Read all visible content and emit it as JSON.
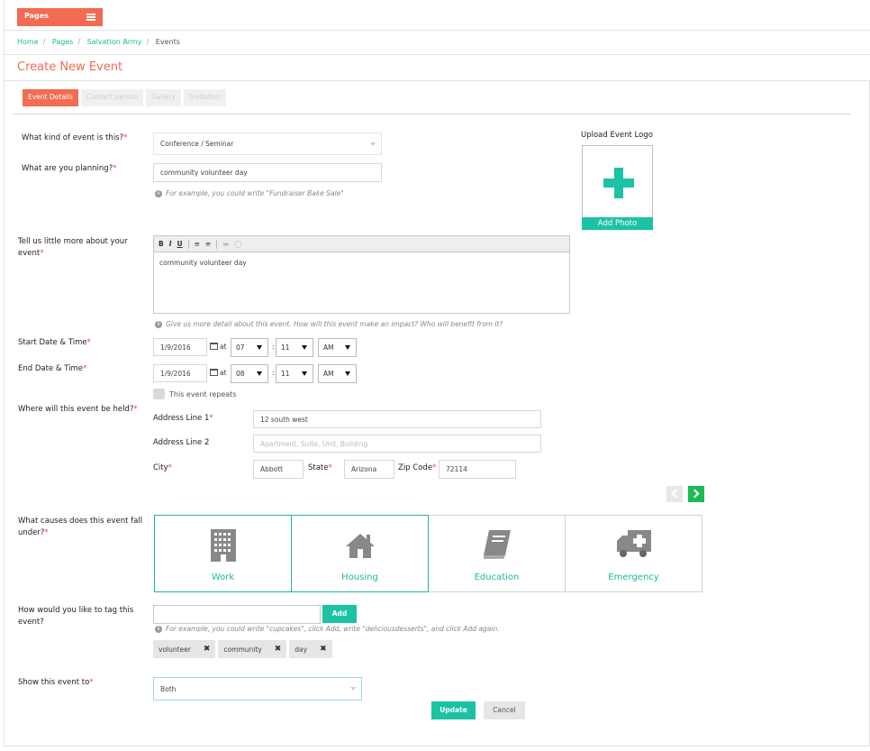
{
  "header": {
    "pages_label": "Pages"
  },
  "breadcrumb": [
    "Home",
    "Pages",
    "Salvation Army",
    "Events"
  ],
  "page_title": "Create New Event",
  "tabs": [
    "Event Details",
    "Contact person",
    "Gallery",
    "Invitation"
  ],
  "form": {
    "event_kind": {
      "label": "What kind of event is this?",
      "value": "Conference / Seminar"
    },
    "planning": {
      "label": "What are you planning?",
      "value": "community volunteer day",
      "hint": "For example, you could write \"Fundraiser Bake Sale\""
    },
    "description": {
      "label_line1": "Tell us little more about your",
      "label_line2": "event",
      "value": "community volunteer day",
      "hint": "Give us more detail about this event. How will this event make an impact? Who will benefit from it?",
      "toolbar": {
        "bold": "B",
        "italic": "I",
        "underline": "U"
      }
    },
    "start": {
      "label": "Start Date & Time",
      "date": "1/9/2016",
      "at": "at",
      "hour": "07",
      "minute": "11",
      "ampm": "AM"
    },
    "end": {
      "label": "End Date & Time",
      "date": "1/9/2016",
      "at": "at",
      "hour": "08",
      "minute": "11",
      "ampm": "AM"
    },
    "repeats_label": "This event repeats",
    "location": {
      "label": "Where will this event be held?",
      "address1_label": "Address Line 1",
      "address1_value": "12 south west",
      "address2_label": "Address Line 2",
      "address2_placeholder": "Apartment, Suite, Unit, Building",
      "city_label": "City",
      "city_value": "Abbott",
      "state_label": "State",
      "state_value": "Arizona",
      "zip_label": "Zip Code",
      "zip_value": "72114"
    },
    "causes": {
      "label_line1": "What causes does this event fall",
      "label_line2": "under?",
      "items": [
        {
          "label": "Work",
          "icon": "building-icon",
          "selected": true
        },
        {
          "label": "Housing",
          "icon": "house-icon",
          "selected": true
        },
        {
          "label": "Education",
          "icon": "book-icon",
          "selected": false
        },
        {
          "label": "Emergency",
          "icon": "ambulance-icon",
          "selected": false
        }
      ]
    },
    "tags": {
      "label_line1": "How would you like to tag this",
      "label_line2": "event?",
      "add_label": "Add",
      "hint": "For example, you could write \"cupcakes\", click Add, write \"deliciousdesserts\", and click Add again.",
      "items": [
        "volunteer",
        "community",
        "day"
      ]
    },
    "visibility": {
      "label": "Show this event to",
      "value": "Both"
    }
  },
  "upload": {
    "title": "Upload Event Logo",
    "button": "Add Photo"
  },
  "actions": {
    "update": "Update",
    "cancel": "Cancel"
  },
  "colors": {
    "accent_coral": "#f26b52",
    "accent_teal": "#1bc3a4",
    "next_green": "#1db954"
  }
}
